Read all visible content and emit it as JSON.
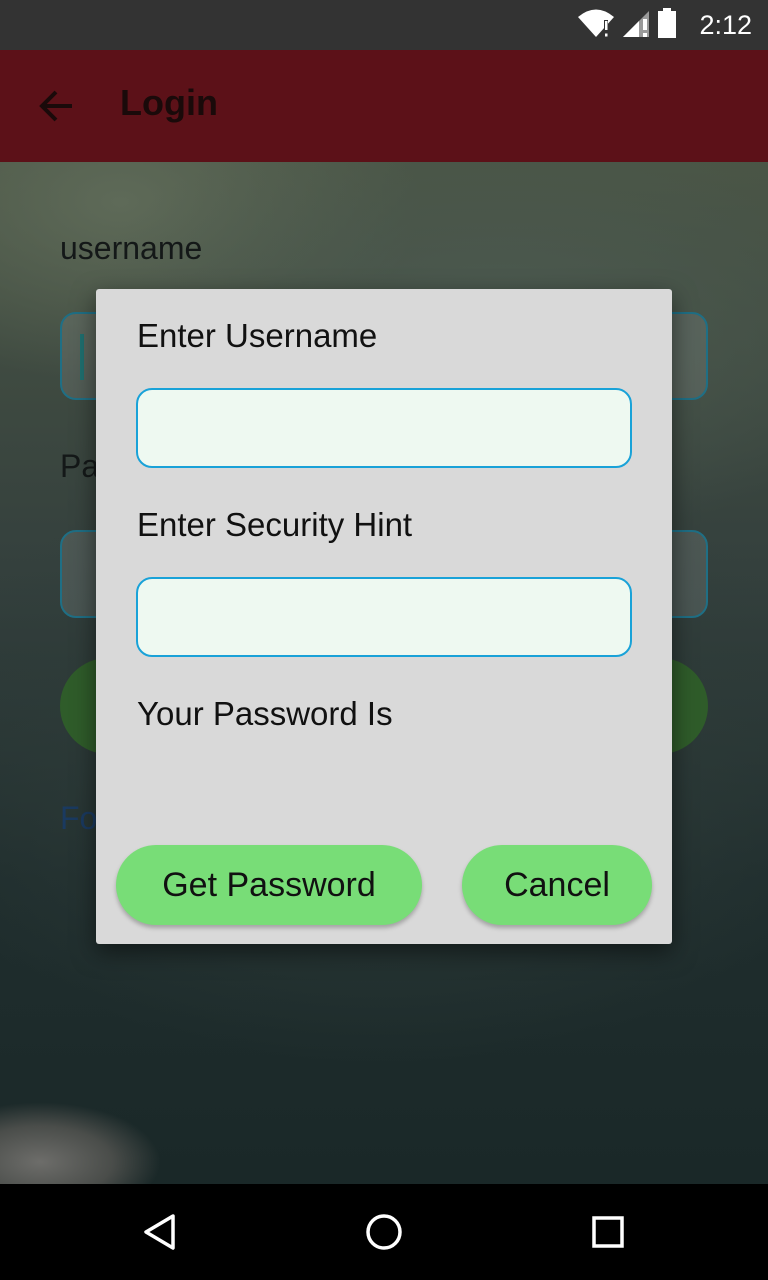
{
  "status_bar": {
    "time": "2:12",
    "icons": [
      "wifi-alert-icon",
      "signal-alert-icon",
      "battery-icon"
    ]
  },
  "app_bar": {
    "title": "Login",
    "back_icon": "arrow-left-icon",
    "color": "#5c1118"
  },
  "background_form": {
    "username_label": "username",
    "password_label": "Pa",
    "forgot_link": "Fo"
  },
  "dialog": {
    "username_label": "Enter Username",
    "username_value": "",
    "hint_label": "Enter Security Hint",
    "hint_value": "",
    "password_label": "Your Password Is",
    "password_value": "",
    "get_password_button": "Get Password",
    "cancel_button": "Cancel",
    "button_color": "#78dd77",
    "input_border_color": "#19a2d8"
  },
  "nav_bar": {
    "icons": [
      "back-triangle-icon",
      "home-circle-icon",
      "recents-square-icon"
    ]
  }
}
